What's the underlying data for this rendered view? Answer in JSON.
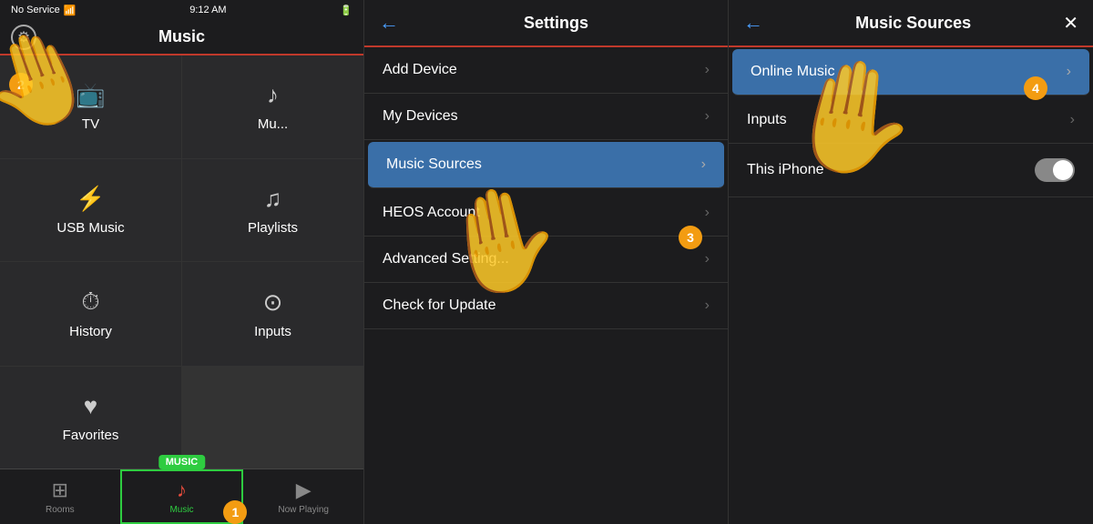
{
  "panel1": {
    "statusBar": {
      "carrier": "No Service",
      "time": "9:12 AM",
      "battery": "Battery"
    },
    "title": "Music",
    "cells": [
      {
        "id": "tv",
        "icon": "📺",
        "label": "TV"
      },
      {
        "id": "music",
        "icon": "♪",
        "label": "Mu..."
      },
      {
        "id": "usb",
        "icon": "⚡",
        "label": "USB Music"
      },
      {
        "id": "playlists",
        "icon": "♫",
        "label": "Playlists"
      },
      {
        "id": "history",
        "icon": "⏱",
        "label": "History"
      },
      {
        "id": "inputs",
        "icon": "⊙",
        "label": "Inputs"
      },
      {
        "id": "favorites",
        "icon": "♥",
        "label": "Favorites"
      }
    ],
    "nav": [
      {
        "id": "rooms",
        "icon": "⊞",
        "label": "Rooms",
        "active": false
      },
      {
        "id": "music",
        "icon": "♪",
        "label": "Music",
        "active": true
      },
      {
        "id": "nowplaying",
        "icon": "▶",
        "label": "Now Playing",
        "active": false
      }
    ],
    "musicBadge": "MUSIC"
  },
  "panel2": {
    "title": "Settings",
    "items": [
      {
        "id": "add-device",
        "label": "Add Device",
        "active": false
      },
      {
        "id": "my-devices",
        "label": "My Devices",
        "active": false
      },
      {
        "id": "music-sources",
        "label": "Music Sources",
        "active": true
      },
      {
        "id": "heos-account",
        "label": "HEOS Account",
        "active": false
      },
      {
        "id": "advanced-settings",
        "label": "Advanced Setting...",
        "active": false
      },
      {
        "id": "check-update",
        "label": "Check for Update",
        "active": false
      }
    ]
  },
  "panel3": {
    "title": "Music Sources",
    "items": [
      {
        "id": "online-music",
        "label": "Online Music",
        "active": true,
        "toggle": null
      },
      {
        "id": "inputs",
        "label": "Inputs",
        "active": false,
        "toggle": null
      },
      {
        "id": "this-iphone",
        "label": "This iPhone",
        "active": false,
        "toggle": "on"
      }
    ]
  },
  "steps": {
    "step1": "1",
    "step2": "2",
    "step3": "3",
    "step4": "4"
  }
}
